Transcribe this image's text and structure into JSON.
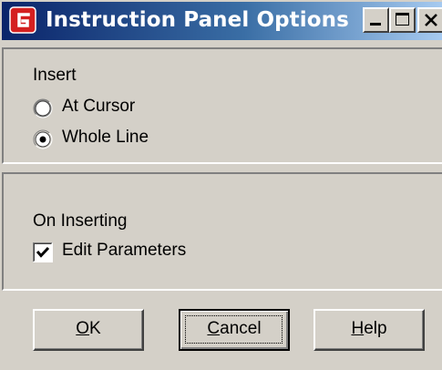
{
  "window": {
    "title": "Instruction Panel Options",
    "icon": "red-shield-app-icon",
    "controls": [
      "minimize-icon",
      "maximize-icon",
      "close-icon"
    ]
  },
  "insert_group": {
    "label": "Insert",
    "options": [
      {
        "label": "At Cursor",
        "selected": false
      },
      {
        "label": "Whole Line",
        "selected": true
      }
    ]
  },
  "inserting_group": {
    "label": "On Inserting",
    "edit_parameters": {
      "label": "Edit Parameters",
      "checked": true
    }
  },
  "buttons": {
    "ok": {
      "mnemonic": "O",
      "rest": "K"
    },
    "cancel": {
      "mnemonic": "C",
      "rest": "ancel"
    },
    "help": {
      "mnemonic": "H",
      "rest": "elp"
    }
  },
  "colors": {
    "titlebar_start": "#0a246a",
    "titlebar_end": "#a6caf0",
    "face": "#d4d0c8",
    "app_icon": "#d42020"
  }
}
